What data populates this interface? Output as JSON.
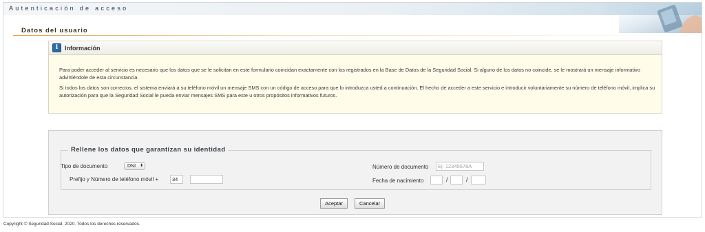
{
  "banner": {
    "title": "Autenticación de acceso"
  },
  "section": {
    "title": "Datos del usuario"
  },
  "info": {
    "icon": "info-icon",
    "title": "Información",
    "paragraph_1": "Para poder acceder al servicio es necesario que los datos que se le solicitan en este formulario coincidan exactamente con los registrados en la Base de Datos de la Seguridad Social. Si alguno de los datos no coincide, se le mostrará un mensaje informativo advirtiéndole de esta circunstancia.",
    "paragraph_2": "Si todos los datos son correctos, el sistema enviará a su teléfono móvil un mensaje SMS con un código de acceso para que lo introduzca usted a continuación. El hecho de acceder a este servicio e introducir voluntariamente su número de teléfono móvil, implica su autorización para que la Seguridad Social le pueda enviar mensajes SMS para este u otros propósitos informativos futuros."
  },
  "form": {
    "legend": "Rellene los datos que garantizan su identidad",
    "tipo_documento": {
      "label": "Tipo de documento",
      "selected": "DNI",
      "arrow": "⬍"
    },
    "numero_documento": {
      "label": "Número de documento",
      "placeholder": "Ej: 12345678A",
      "value": ""
    },
    "telefono": {
      "label": "Prefijo y Número de teléfono móvil +",
      "prefix": "34",
      "number": ""
    },
    "fecha_nacimiento": {
      "label": "Fecha de nacimiento",
      "day": "",
      "month": "",
      "year": "",
      "separator": "/"
    },
    "buttons": {
      "accept": "Aceptar",
      "cancel": "Cancelar"
    }
  },
  "footer": {
    "copyright": "Copyright © Seguridad Social. 2020. Todos los derechos reservados."
  },
  "colors": {
    "accent": "#2f6aa8",
    "info_bg": "#fffcea",
    "form_bg": "#f2f2f2",
    "rule": "#e0a050"
  }
}
